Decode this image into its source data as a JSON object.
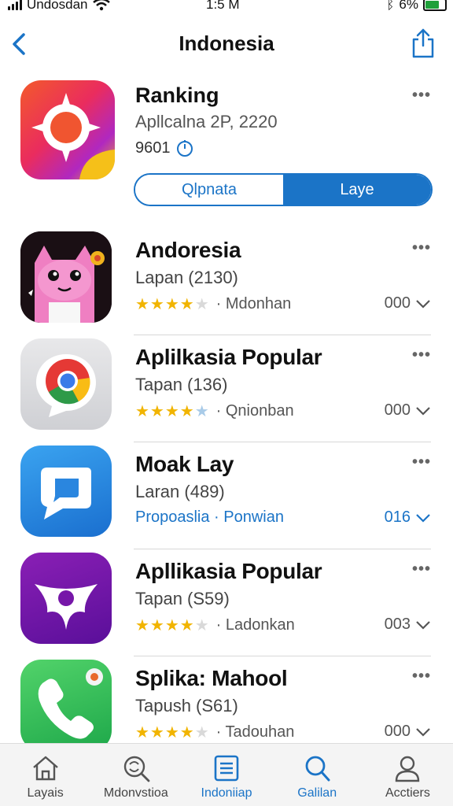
{
  "status_bar": {
    "carrier": "Undosdan",
    "time": "1:5 M",
    "battery": "6%"
  },
  "nav": {
    "title": "Indonesia"
  },
  "featured": {
    "name": "Ranking",
    "subtitle": "Apllcalna 2P, 2220",
    "meta": "9601",
    "segment": {
      "left": "Qlpnata",
      "right": "Laye"
    }
  },
  "apps": [
    {
      "name": "Andoresia",
      "subtitle": "Lapan (2130)",
      "rating": 4,
      "category": "· Mdonhan",
      "count": "000",
      "icon": "cat-icon",
      "style": "normal"
    },
    {
      "name": "Aplilkasia Popular",
      "subtitle": "Tapan (136)",
      "rating": 4,
      "category": "· Qnionban",
      "count": "000",
      "icon": "chrome-chat-icon",
      "style": "normal"
    },
    {
      "name": "Moak Lay",
      "subtitle": "Laran (489)",
      "rating": 0,
      "category": "Propoaslia · Ponwian",
      "count": "016",
      "icon": "chat-bubble-icon",
      "style": "blue"
    },
    {
      "name": "Apllikasia Popular",
      "subtitle": "Tapan (S59)",
      "rating": 4,
      "category": "· Ladonkan",
      "count": "003",
      "icon": "star-shape-icon",
      "style": "normal"
    },
    {
      "name": "Splika: Mahool",
      "subtitle": "Tapush (S61)",
      "rating": 4,
      "category": "· Tadouhan",
      "count": "000",
      "icon": "phone-icon",
      "style": "normal"
    }
  ],
  "tabbar": [
    {
      "label": "Layais",
      "icon": "home-icon"
    },
    {
      "label": "Mdonvstioa",
      "icon": "search-refresh-icon"
    },
    {
      "label": "Indoniiap",
      "icon": "list-icon",
      "active": true
    },
    {
      "label": "Galilan",
      "icon": "search-icon"
    },
    {
      "label": "Acctiers",
      "icon": "person-icon"
    }
  ],
  "colors": {
    "accent": "#1b74c7",
    "star": "#f1b400"
  }
}
